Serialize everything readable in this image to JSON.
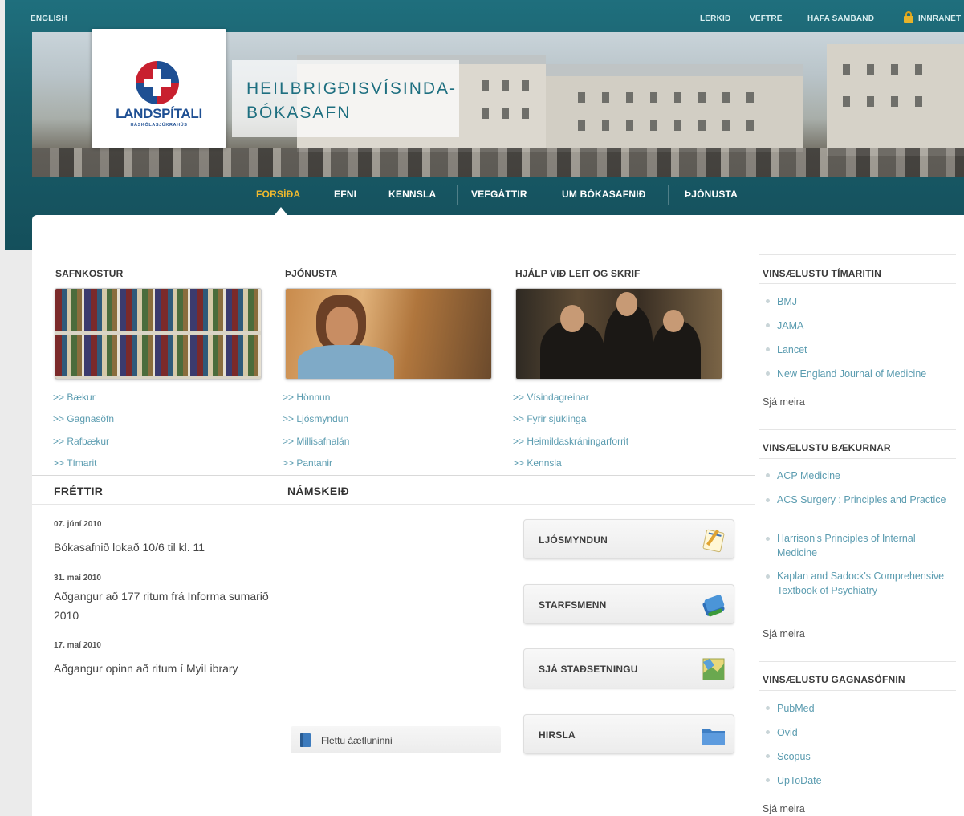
{
  "topbar": {
    "language": "ENGLISH",
    "links": [
      "LERKIÐ",
      "VEFTRÉ",
      "HAFA SAMBAND",
      "INNRANET"
    ]
  },
  "brand": {
    "logo_text": "LANDSPÍTALI",
    "logo_subtext": "HÁSKÓLASJÚKRAHÚS",
    "title_line1": "HEILBRIGÐISVÍSINDA-",
    "title_line2": "BÓKASAFN"
  },
  "nav": {
    "items": [
      "FORSÍÐA",
      "EFNI",
      "KENNSLA",
      "VEFGÁTTIR",
      "UM BÓKASAFNIÐ",
      "ÞJÓNUSTA"
    ],
    "active_index": 0
  },
  "columns": [
    {
      "heading": "SAFNKOSTUR",
      "links": [
        ">> Bækur",
        ">> Gagnasöfn",
        ">> Rafbækur",
        ">> Tímarit"
      ]
    },
    {
      "heading": "ÞJÓNUSTA",
      "links": [
        ">> Hönnun",
        ">> Ljósmyndun",
        ">> Millisafnalán",
        ">> Pantanir"
      ]
    },
    {
      "heading": "HJÁLP VIÐ LEIT OG SKRIF",
      "links": [
        ">> Vísindagreinar",
        ">> Fyrir sjúklinga",
        ">> Heimildaskráningarforrit",
        ">> Kennsla"
      ]
    }
  ],
  "news": {
    "heading": "FRÉTTIR",
    "items": [
      {
        "date": "07. júní 2010",
        "title": "Bókasafnið lokað 10/6 til kl. 11"
      },
      {
        "date": "31. maí 2010",
        "title": "Aðgangur að 177 ritum frá Informa sumarið 2010"
      },
      {
        "date": "17. maí 2010",
        "title": "Aðgangur opinn að ritum í MyiLibrary"
      }
    ]
  },
  "courses": {
    "heading": "NÁMSKEIÐ",
    "browse_label": "Flettu áætluninni"
  },
  "shortcuts": [
    "LJÓSMYNDUN",
    "STARFSMENN",
    "SJÁ STAÐSETNINGU",
    "HIRSLA"
  ],
  "sidebar": {
    "journals": {
      "heading": "VINSÆLUSTU TÍMARITIN",
      "items": [
        "BMJ",
        "JAMA",
        "Lancet",
        "New England Journal of Medicine"
      ],
      "more": "Sjá meira"
    },
    "books": {
      "heading": "VINSÆLUSTU BÆKURNAR",
      "items": [
        "ACP Medicine",
        "ACS Surgery : Principles and Practice",
        "Harrison's Principles of Internal Medicine",
        "Kaplan and Sadock's Comprehensive Textbook of Psychiatry"
      ],
      "more": "Sjá meira"
    },
    "databases": {
      "heading": "VINSÆLUSTU GAGNASÖFNIN",
      "items": [
        "PubMed",
        "Ovid",
        "Scopus",
        "UpToDate"
      ],
      "more": "Sjá meira"
    }
  },
  "colors": {
    "header_teal": "#1a5e6b",
    "nav_active": "#f0b92e",
    "link": "#5b9cb0",
    "logo_blue": "#1e4f93",
    "logo_red": "#c8202f"
  }
}
